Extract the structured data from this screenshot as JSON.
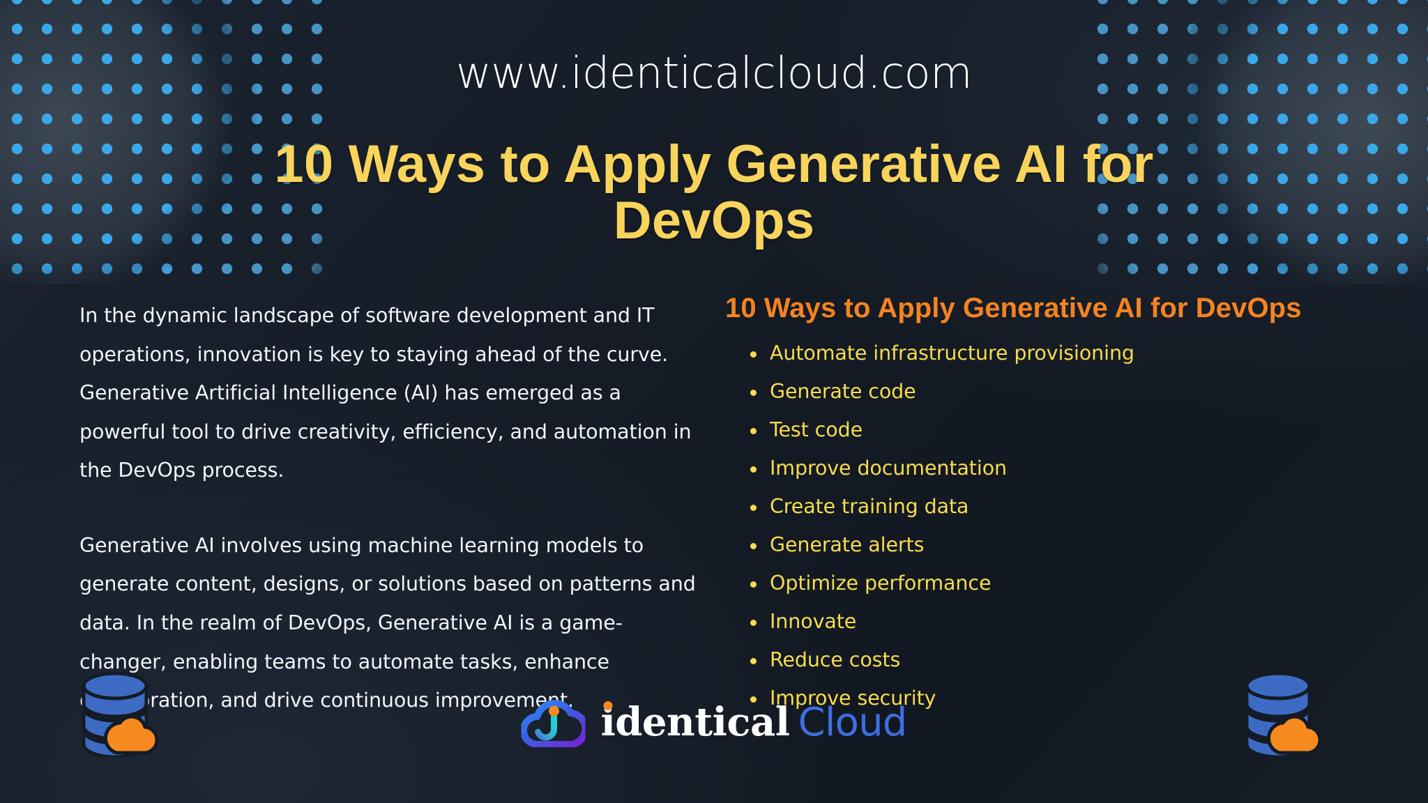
{
  "site": {
    "url": "www.identicalcloud.com"
  },
  "headline": "10 Ways to Apply Generative AI for DevOps",
  "article": {
    "paragraphs": [
      "In the dynamic landscape of software development and IT operations, innovation is key to staying ahead of the curve. Generative Artificial Intelligence (AI) has emerged as a powerful tool to drive creativity, efficiency, and automation in the DevOps process.",
      "Generative AI involves using machine learning models to generate content, designs, or solutions based on patterns and data. In the realm of DevOps, Generative AI is a game-changer, enabling teams to automate tasks, enhance collaboration, and drive continuous improvement."
    ]
  },
  "ways": {
    "title": "10 Ways to Apply Generative AI for DevOps",
    "items": [
      "Automate infrastructure provisioning",
      "Generate code",
      "Test code",
      "Improve documentation",
      "Create training data",
      "Generate alerts",
      "Optimize performance",
      "Innovate",
      "Reduce costs",
      "Improve security"
    ]
  },
  "brand": {
    "name_primary": "identical",
    "name_secondary": "Cloud"
  },
  "icons": {
    "database_cloud": "database-cloud-icon",
    "brand_mark": "cloud-person-logo-icon",
    "halftone": "halftone-dots-decoration"
  },
  "colors": {
    "background": "#151c26",
    "headline_yellow": "#f8d45c",
    "list_title_orange": "#f58320",
    "list_item_yellow": "#f7dc4e",
    "body_white": "#f2f5f8",
    "dot_blue": "#3aa8e8",
    "database_blue": "#3d6bc4",
    "cloud_orange": "#f68a1e",
    "brand_blue": "#3d6fe0"
  }
}
